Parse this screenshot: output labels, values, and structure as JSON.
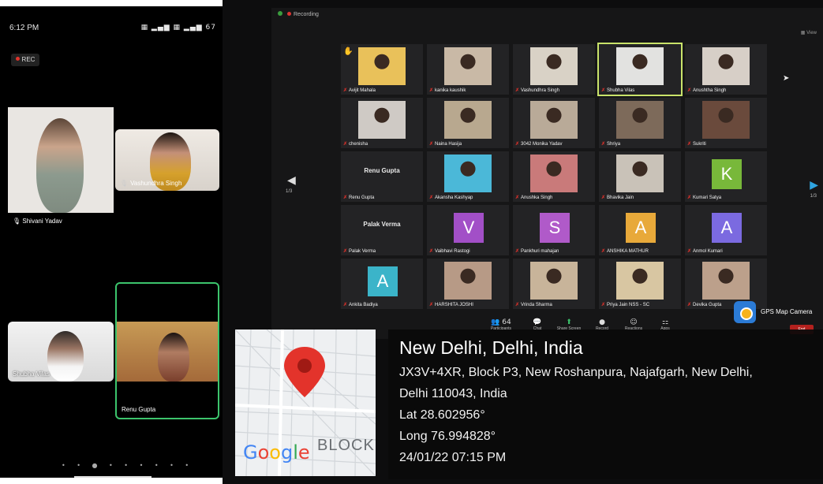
{
  "phone": {
    "status_time": "6:12 PM",
    "status_icons": "▦ ▂▄▆ ▦ ▂▄▆ 67",
    "rec_label": "REC",
    "participants": [
      {
        "name": "Shivani Yadav"
      },
      {
        "name": "Vashundhra Singh"
      },
      {
        "name": "Shubha Vilas"
      },
      {
        "name": "Renu Gupta"
      }
    ],
    "page_dots": "• • ● • • • • • •"
  },
  "monitor": {
    "recording_label": "Recording",
    "view_label": "View",
    "left_page": "1/3",
    "right_page": "1/3",
    "tiles": [
      {
        "name": "Avijit Mahala",
        "kind": "cam",
        "tone": "#e9c15a"
      },
      {
        "name": "kanika kaushik",
        "kind": "cam",
        "tone": "#c9b9a6"
      },
      {
        "name": "Vashundhra Singh",
        "kind": "cam",
        "tone": "#d9d2c6"
      },
      {
        "name": "Shubha Vilas",
        "kind": "cam",
        "tone": "#e2e2e0",
        "active": true
      },
      {
        "name": "Anushtha Singh",
        "kind": "cam",
        "tone": "#d7cfc7"
      },
      {
        "name": "chenisha",
        "kind": "cam",
        "tone": "#cfcac5"
      },
      {
        "name": "Naina Hasija",
        "kind": "cam",
        "tone": "#b8a88f"
      },
      {
        "name": "3042 Monika Yadav",
        "kind": "cam",
        "tone": "#b9aa98"
      },
      {
        "name": "Shriya",
        "kind": "cam",
        "tone": "#7d6a5a"
      },
      {
        "name": "Sukriti",
        "kind": "cam",
        "tone": "#6a4a3c"
      },
      {
        "name": "Renu Gupta",
        "kind": "name",
        "display": "Renu Gupta"
      },
      {
        "name": "Akansha Kashyap",
        "kind": "cam",
        "tone": "#4bb8d8"
      },
      {
        "name": "Anushka Singh",
        "kind": "cam",
        "tone": "#c97a7a"
      },
      {
        "name": "Bhavika Jain",
        "kind": "cam",
        "tone": "#c9c2b8"
      },
      {
        "name": "Kumari Satya",
        "kind": "avatar",
        "letter": "K",
        "color": "#78b83a"
      },
      {
        "name": "Palak Verma",
        "kind": "name",
        "display": "Palak Verma"
      },
      {
        "name": "Vaibhavi Rastogi",
        "kind": "avatar",
        "letter": "V",
        "color": "#a24fc7"
      },
      {
        "name": "Pankhuri mahajan",
        "kind": "avatar",
        "letter": "S",
        "color": "#b05ac9"
      },
      {
        "name": "ANSHIKA MATHUR",
        "kind": "avatar",
        "letter": "A",
        "color": "#e8a93a"
      },
      {
        "name": "Anmol Kumari",
        "kind": "avatar",
        "letter": "A",
        "color": "#7b6ae0"
      },
      {
        "name": "Ankita Badiya",
        "kind": "avatar",
        "letter": "A",
        "color": "#3bb4c9"
      },
      {
        "name": "HARSHITA JOSHI",
        "kind": "cam",
        "tone": "#b79a86"
      },
      {
        "name": "Vrinda Sharma",
        "kind": "cam",
        "tone": "#c8b49a"
      },
      {
        "name": "Priya Jain NSS - SC",
        "kind": "cam",
        "tone": "#d8c6a2"
      },
      {
        "name": "Devika Gupta",
        "kind": "cam",
        "tone": "#bca08b"
      }
    ],
    "toolbar": [
      {
        "label": "Participants",
        "icon": "👥 64"
      },
      {
        "label": "Chat",
        "icon": "💬"
      },
      {
        "label": "Share Screen",
        "icon": "⬆"
      },
      {
        "label": "Record",
        "icon": "●"
      },
      {
        "label": "Reactions",
        "icon": "☺"
      },
      {
        "label": "Apps",
        "icon": "⚏"
      }
    ],
    "end_label": "End"
  },
  "gps": {
    "app_name": "GPS Map Camera",
    "map_block_text": "BLOCK",
    "map_brand": "Google",
    "title": "New Delhi, Delhi, India",
    "address_line1": "JX3V+4XR, Block P3, New Roshanpura, Najafgarh, New Delhi,",
    "address_line2": "Delhi 110043, India",
    "lat": "Lat 28.602956°",
    "long": "Long 76.994828°",
    "datetime": "24/01/22 07:15 PM",
    "pin_color": "#e3332b"
  }
}
